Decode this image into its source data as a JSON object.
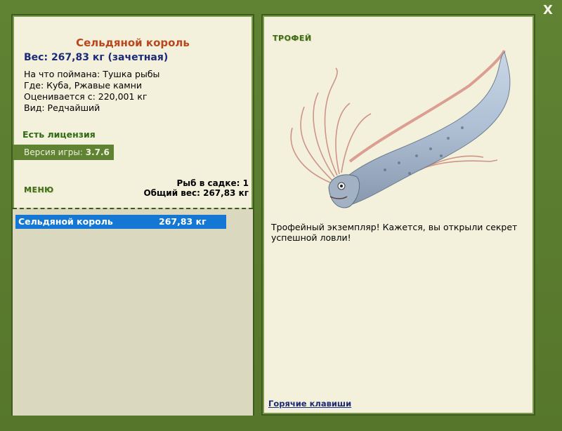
{
  "close_label": "X",
  "fish": {
    "title": "Сельдяной король",
    "weight": "Вес: 267,83 кг (зачетная)",
    "caught_on": "На что поймана: Тушка рыбы",
    "location": "Где: Куба, Ржавые камни",
    "valued_from": "Оценивается с: 220,001 кг",
    "rarity": "Вид: Редчайший"
  },
  "license": "Есть лицензия",
  "version": {
    "label": "Версия игры: ",
    "value": "3.7.6"
  },
  "menu_label": "МЕНЮ",
  "stats": {
    "fish_in_keepnet": "Рыб в садке: 1",
    "total_weight": "Общий вес: 267,83 кг"
  },
  "catch_list": [
    {
      "name": "Сельдяной король",
      "weight": "267,83 кг"
    }
  ],
  "trophy_label": "ТРОФЕЙ",
  "description": "Трофейный экземпляр! Кажется, вы открыли секрет успешной ловли!",
  "hotkeys_link": "Горячие клавиши",
  "colors": {
    "frame": "#5f8233",
    "panel": "#f3f1dc",
    "title": "#b8461e",
    "weight": "#1c2a78",
    "selected_row": "#1577d4"
  }
}
